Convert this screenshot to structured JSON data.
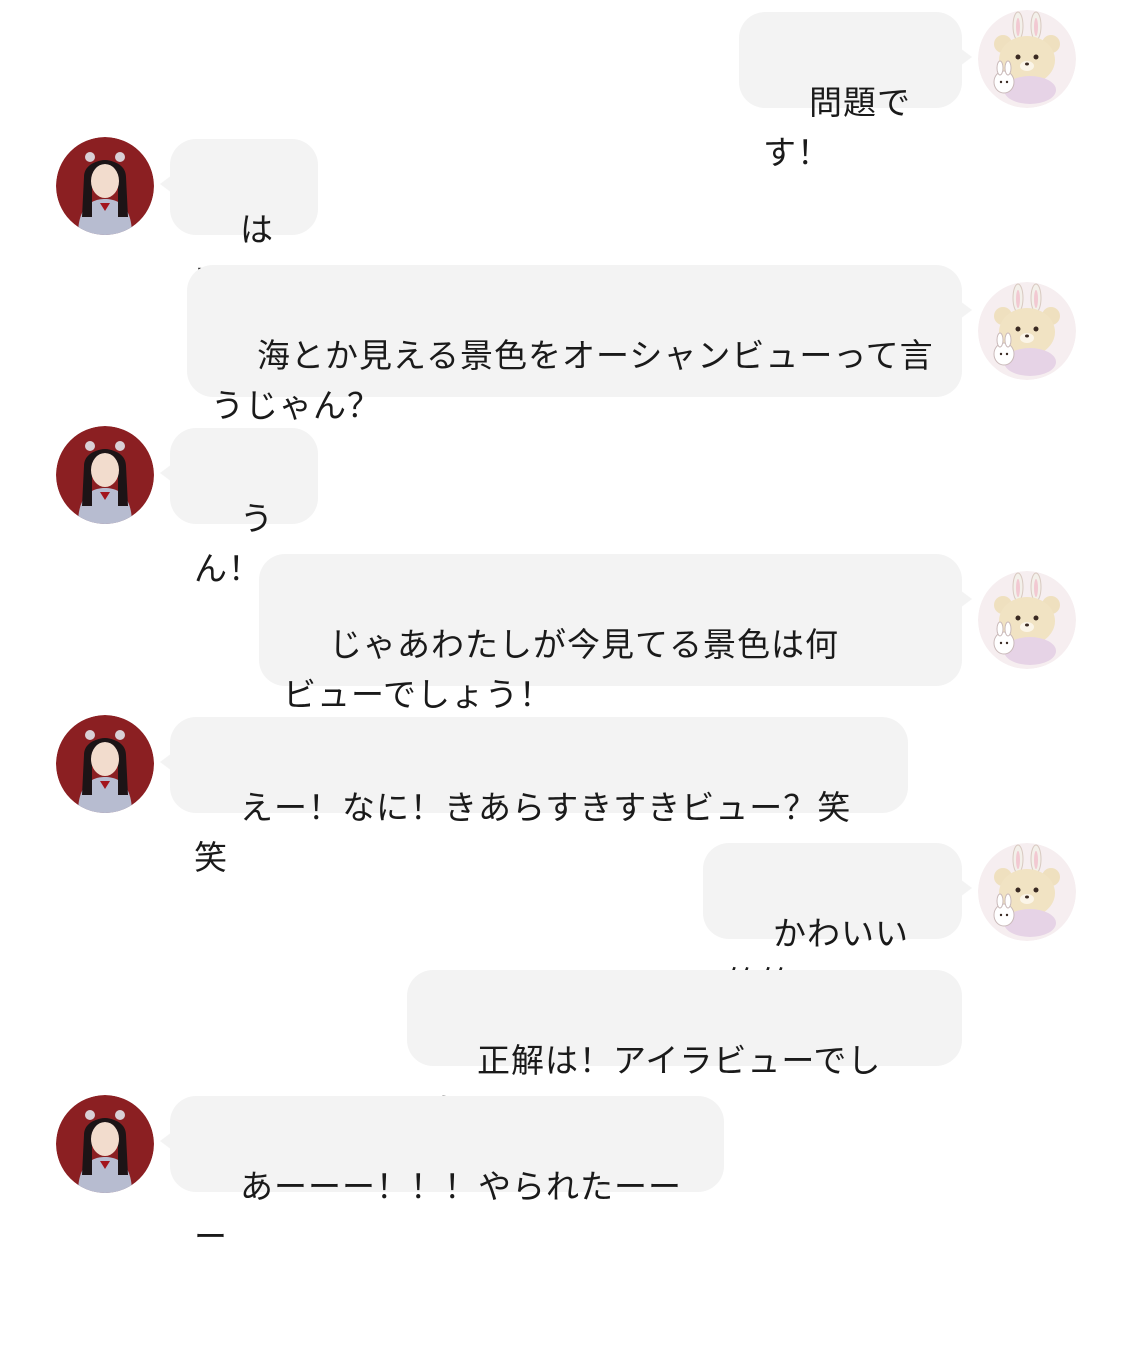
{
  "messages": [
    {
      "from": "bear",
      "text": "問題です！"
    },
    {
      "from": "girl",
      "text": "はい！"
    },
    {
      "from": "bear",
      "text": "海とか見える景色をオーシャンビューって言\nうじゃん？"
    },
    {
      "from": "girl",
      "text": "うん！"
    },
    {
      "from": "bear",
      "text": "じゃあわたしが今見てる景色は何\nビューでしょう！"
    },
    {
      "from": "girl",
      "text": "えー！なに！きあらすきすきビュー？笑笑"
    },
    {
      "from": "bear",
      "text": "かわいい笑笑"
    },
    {
      "from": "bear",
      "text": "正解は！アイラビューでした！"
    },
    {
      "from": "girl",
      "text": "あーーー！！！やられたーーー"
    }
  ],
  "avatars": {
    "girl": "girl-avatar",
    "bear": "bear-bunny-avatar"
  },
  "colors": {
    "bubble": "#f3f3f3",
    "background": "#ffffff",
    "text": "#1a1a1a",
    "girl_avatar_bg": "#8b1f22",
    "bear_avatar_bg": "#f6eef0"
  }
}
